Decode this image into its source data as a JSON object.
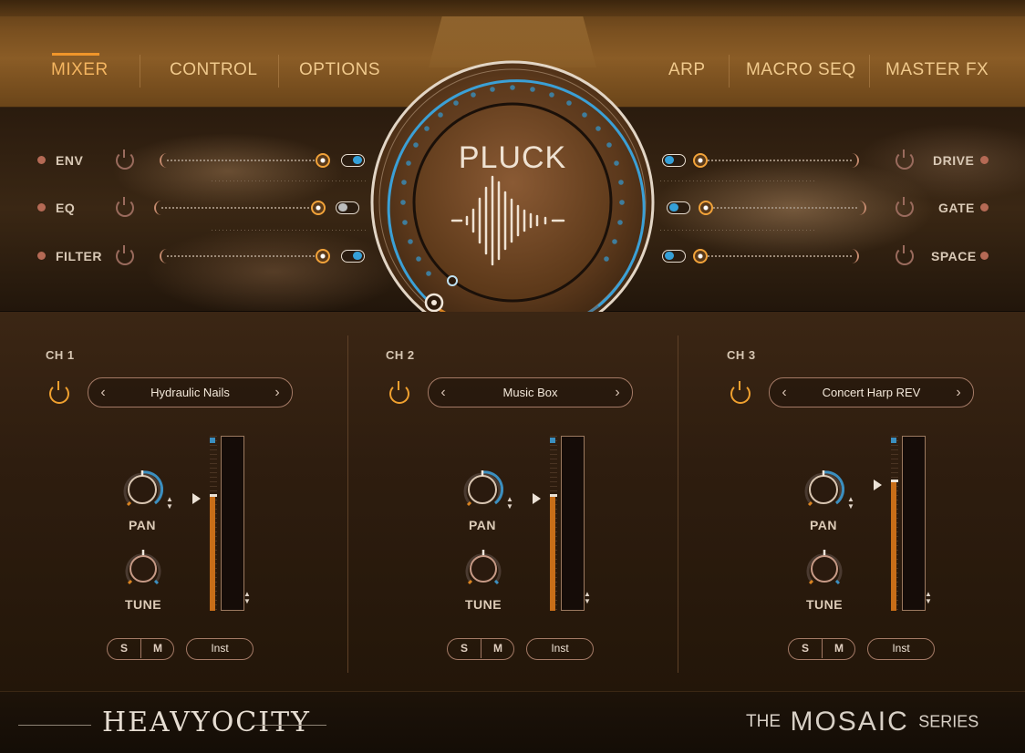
{
  "nav": {
    "left_tabs": [
      {
        "label": "MIXER",
        "active": true
      },
      {
        "label": "CONTROL",
        "active": false
      },
      {
        "label": "OPTIONS",
        "active": false
      }
    ],
    "right_tabs": [
      {
        "label": "ARP"
      },
      {
        "label": "MACRO SEQ"
      },
      {
        "label": "MASTER FX"
      }
    ]
  },
  "mod_panel": {
    "left": [
      {
        "label": "ENV"
      },
      {
        "label": "EQ"
      },
      {
        "label": "FILTER"
      }
    ],
    "right": [
      {
        "label": "DRIVE"
      },
      {
        "label": "GATE"
      },
      {
        "label": "SPACE"
      }
    ]
  },
  "center_dial": {
    "title": "PLUCK",
    "icon": "waveform-icon"
  },
  "channels": [
    {
      "label": "CH 1",
      "preset": "Hydraulic Nails",
      "pan_label": "PAN",
      "tune_label": "TUNE",
      "solo": "S",
      "mute": "M",
      "output": "Inst"
    },
    {
      "label": "CH 2",
      "preset": "Music Box",
      "pan_label": "PAN",
      "tune_label": "TUNE",
      "solo": "S",
      "mute": "M",
      "output": "Inst"
    },
    {
      "label": "CH 3",
      "preset": "Concert Harp REV",
      "pan_label": "PAN",
      "tune_label": "TUNE",
      "solo": "S",
      "mute": "M",
      "output": "Inst"
    }
  ],
  "footer": {
    "brand": "HEAVYOCITY",
    "series_prefix": "THE",
    "series_name": "MOSAIC",
    "series_suffix": "SERIES"
  },
  "colors": {
    "accent_orange": "#f0a02f",
    "accent_blue": "#35a0d8",
    "brown_dark": "#2e1d0f"
  }
}
